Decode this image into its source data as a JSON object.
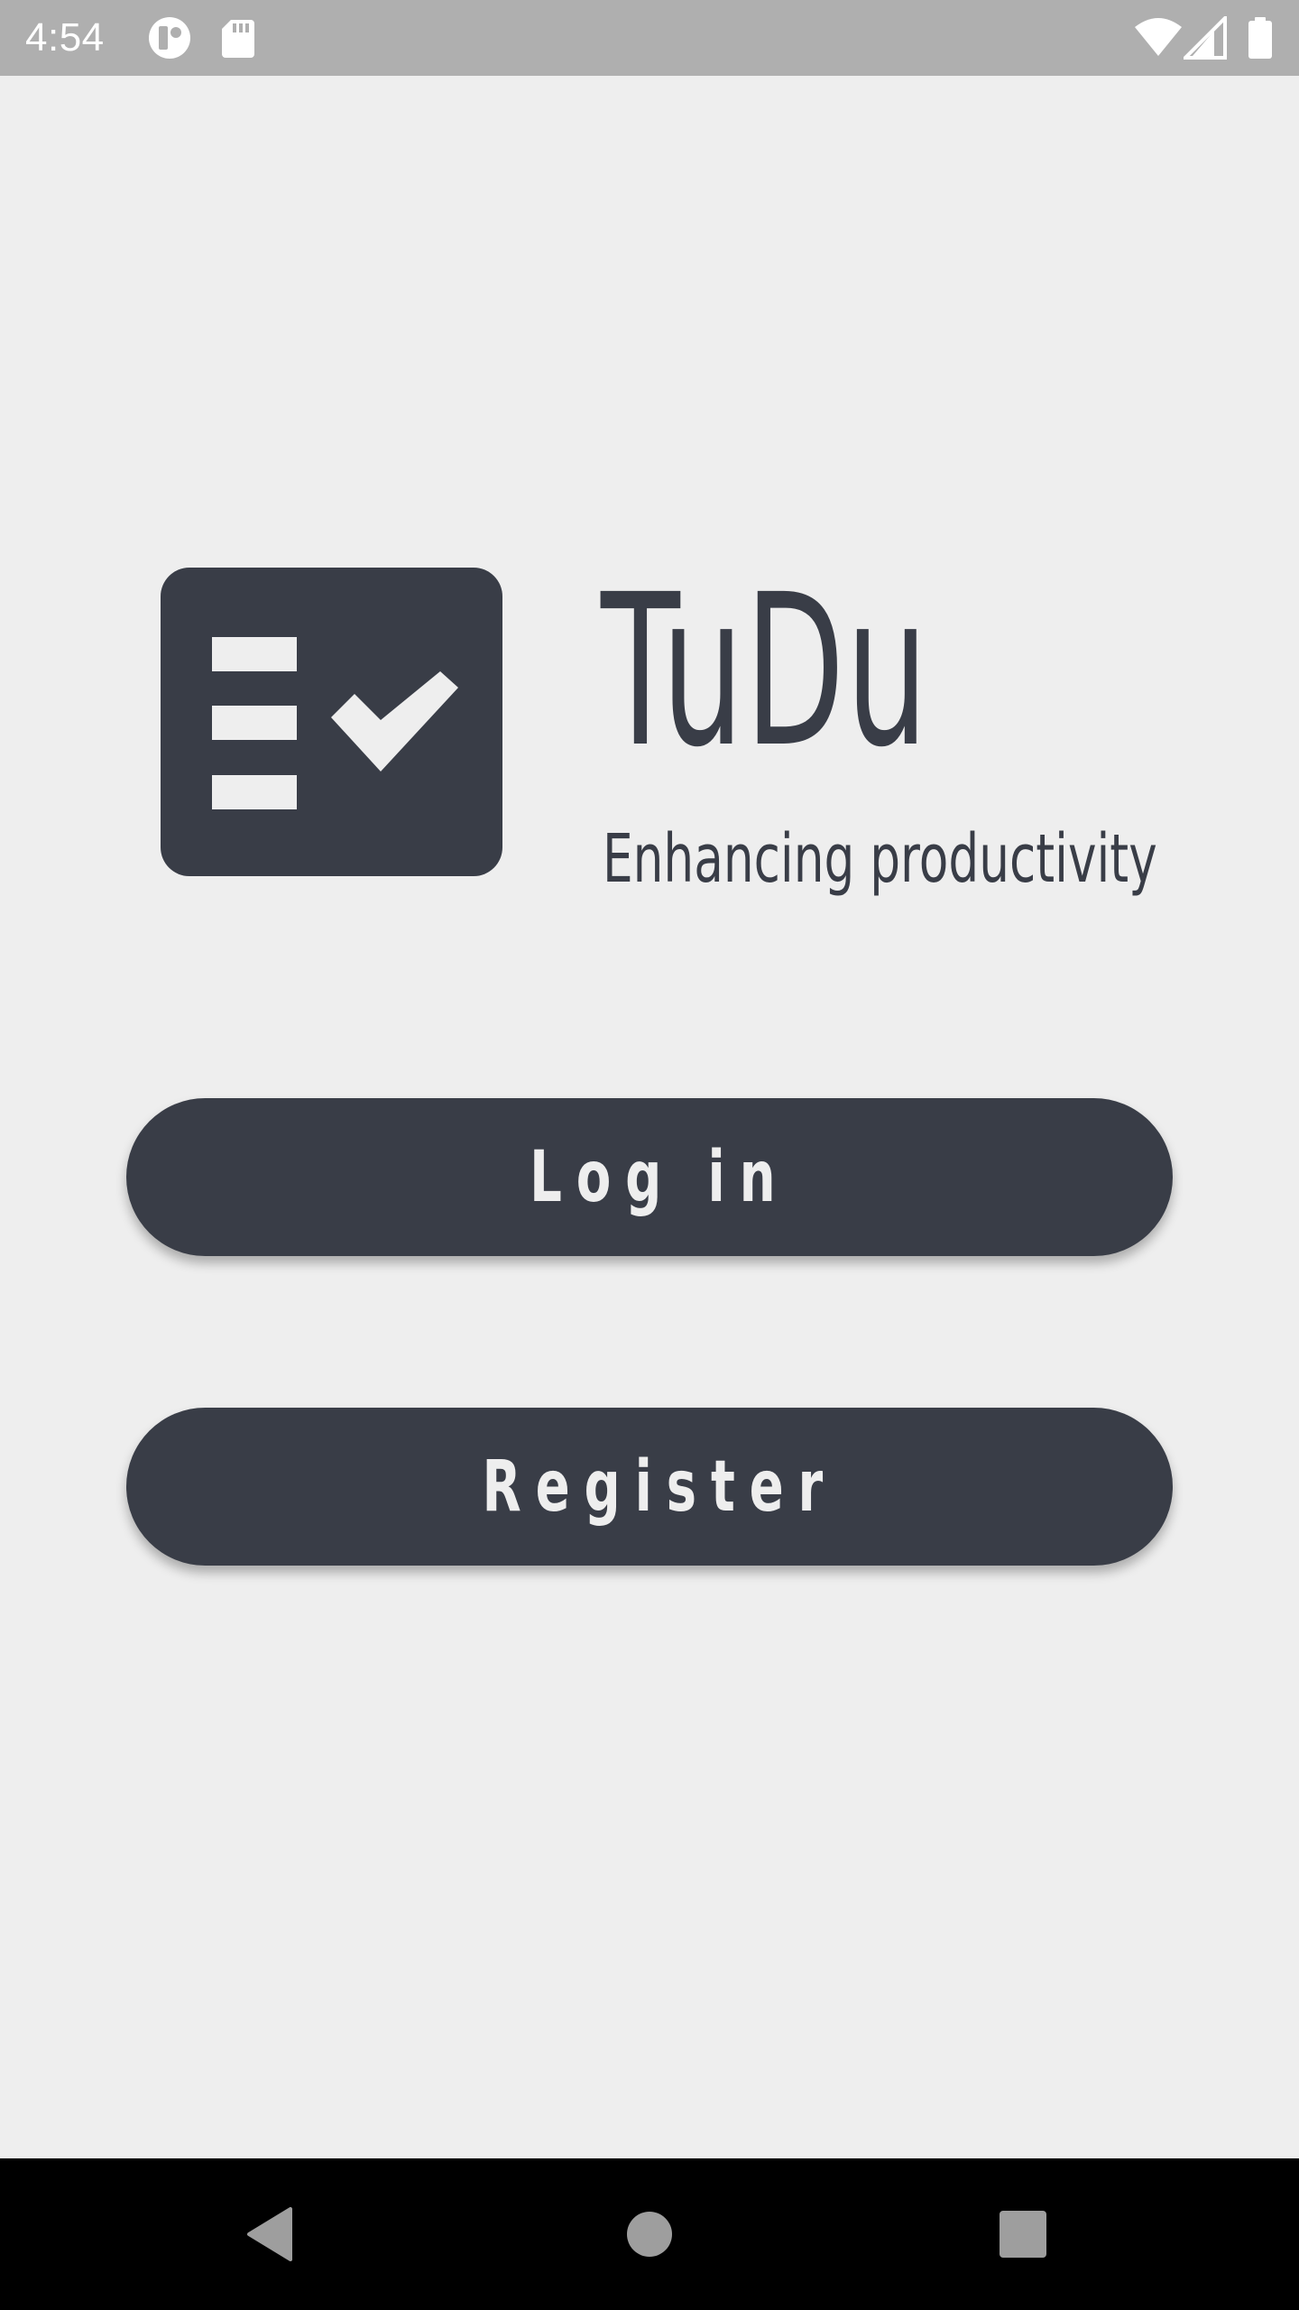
{
  "status_bar": {
    "time": "4:54",
    "icons": [
      "cast-app-icon",
      "sd-card-icon",
      "wifi-icon",
      "cell-signal-icon",
      "battery-icon"
    ]
  },
  "app": {
    "logo_icon": "checklist-icon",
    "title": "TuDu",
    "subtitle": "Enhancing productivity"
  },
  "buttons": {
    "login_label": "Log in",
    "register_label": "Register"
  },
  "nav_bar": {
    "icons": [
      "back-icon",
      "home-icon",
      "recents-icon"
    ]
  },
  "colors": {
    "background": "#eeeeee",
    "primary": "#393d47",
    "status_bar": "#afafaf",
    "nav_bar": "#000000",
    "button_text": "#eeeeee"
  }
}
